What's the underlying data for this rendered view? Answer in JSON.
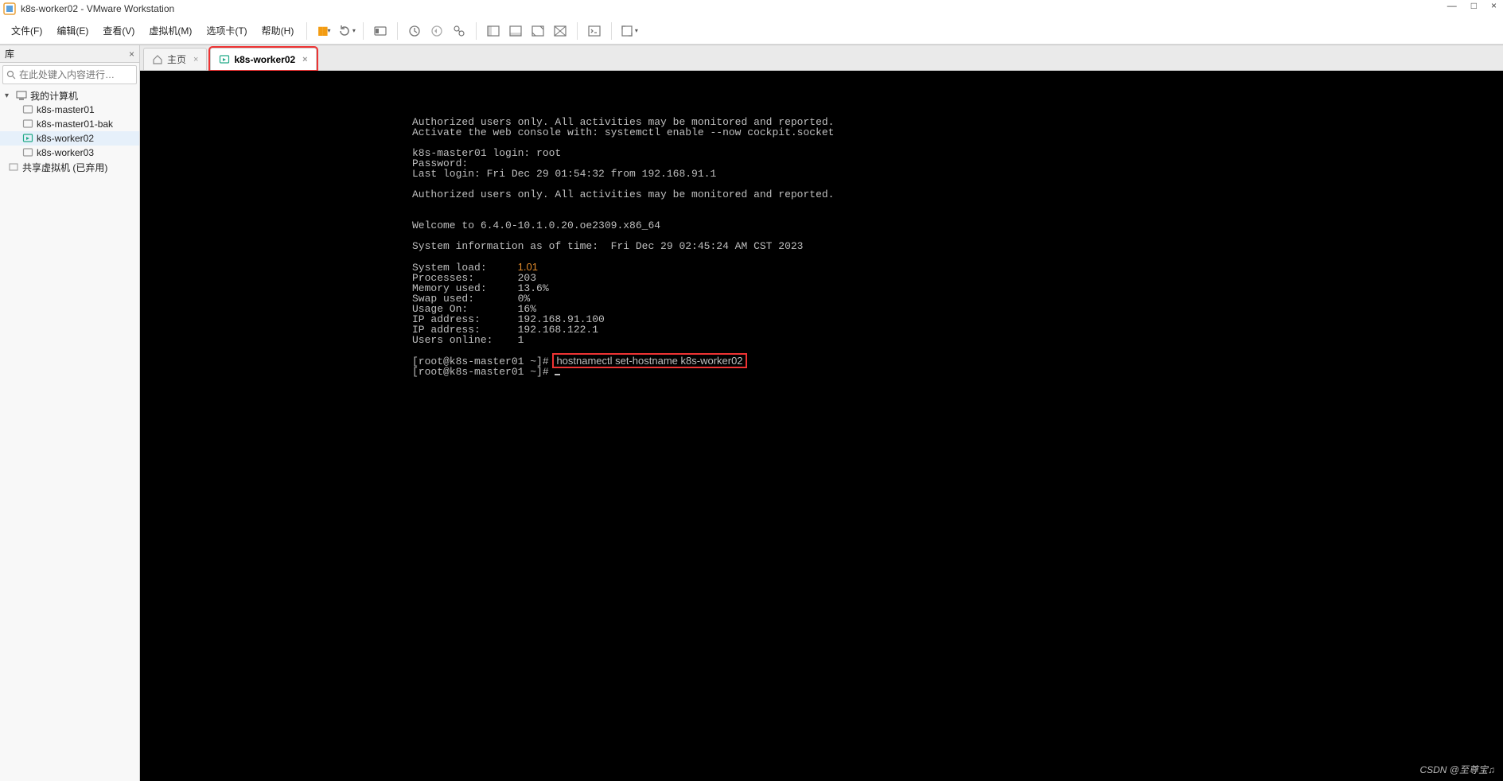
{
  "title": "k8s-worker02 - VMware Workstation",
  "menus": {
    "file": "文件(F)",
    "edit": "编辑(E)",
    "view": "查看(V)",
    "vm": "虚拟机(M)",
    "tabs": "选项卡(T)",
    "help": "帮助(H)"
  },
  "sidebar": {
    "header": "库",
    "search_placeholder": "在此处键入内容进行…",
    "root": "我的计算机",
    "items": [
      "k8s-master01",
      "k8s-master01-bak",
      "k8s-worker02",
      "k8s-worker03"
    ],
    "selected_index": 2,
    "shared": "共享虚拟机 (已弃用)"
  },
  "tabs": [
    {
      "label": "主页",
      "type": "home"
    },
    {
      "label": "k8s-worker02",
      "type": "vm",
      "active": true,
      "highlight": true
    }
  ],
  "icons": {
    "search": "search",
    "close": "×",
    "minimize": "—",
    "maximize": "□",
    "win_close": "×",
    "pause": "pause",
    "restart": "restart",
    "snapshot_take": "snap_take",
    "snapshot_revert": "snap_rev",
    "snapshot_manage": "snap_mgr",
    "layout1": "layout1",
    "layout2": "layout2",
    "layout3": "layout3",
    "layout4": "layout4",
    "cli": "cli",
    "fullscreen": "fullscreen",
    "home": "home",
    "vm_on": "vm_on",
    "vm_off": "vm_off",
    "app": "app"
  },
  "watermark": "CSDN @至尊宝♫",
  "terminal": {
    "lines": [
      "Authorized users only. All activities may be monitored and reported.",
      "Activate the web console with: systemctl enable --now cockpit.socket",
      "",
      "k8s-master01 login: root",
      "Password:",
      "Last login: Fri Dec 29 01:54:32 from 192.168.91.1",
      "",
      "Authorized users only. All activities may be monitored and reported.",
      "",
      "",
      "Welcome to 6.4.0-10.1.0.20.oe2309.x86_64",
      "",
      "System information as of time:  Fri Dec 29 02:45:24 AM CST 2023",
      ""
    ],
    "stats": [
      {
        "label": "System load:",
        "value": "1.01",
        "orange": true
      },
      {
        "label": "Processes:",
        "value": "203"
      },
      {
        "label": "Memory used:",
        "value": "13.6%"
      },
      {
        "label": "Swap used:",
        "value": "0%"
      },
      {
        "label": "Usage On:",
        "value": "16%"
      },
      {
        "label": "IP address:",
        "value": "192.168.91.100"
      },
      {
        "label": "IP address:",
        "value": "192.168.122.1"
      },
      {
        "label": "Users online:",
        "value": "1"
      }
    ],
    "prompt1": "[root@k8s-master01 ~]# ",
    "cmd": "hostnamectl set-hostname k8s-worker02",
    "prompt2": "[root@k8s-master01 ~]# "
  }
}
